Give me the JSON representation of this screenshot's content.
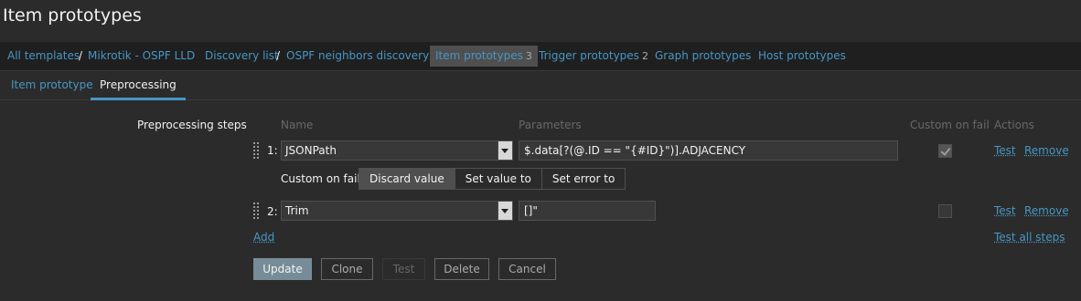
{
  "page": {
    "title": "Item prototypes"
  },
  "breadcrumbs": {
    "all_templates": "All templates",
    "template": "Mikrotik - OSPF LLD",
    "discovery_list": "Discovery list",
    "discovery_rule": "OSPF neighbors discovery",
    "item_prototypes": "Item prototypes",
    "item_prototypes_count": "3",
    "trigger_prototypes": "Trigger prototypes",
    "trigger_prototypes_count": "2",
    "graph_prototypes": "Graph prototypes",
    "host_prototypes": "Host prototypes",
    "separator": "/"
  },
  "tabs": [
    {
      "label": "Item prototype",
      "active": false
    },
    {
      "label": "Preprocessing",
      "active": true
    }
  ],
  "preprocessing": {
    "label": "Preprocessing steps",
    "columns": {
      "name": "Name",
      "parameters": "Parameters",
      "custom_on_fail": "Custom on fail",
      "actions": "Actions"
    },
    "steps": [
      {
        "num": "1:",
        "name": "JSONPath",
        "param": "$.data[?(@.ID == \"{#ID}\")].ADJACENCY",
        "custom_on_fail": true,
        "test": "Test",
        "remove": "Remove"
      },
      {
        "num": "2:",
        "name": "Trim",
        "param": "[]\"",
        "custom_on_fail": false,
        "test": "Test",
        "remove": "Remove"
      }
    ],
    "custom_on_fail_row": {
      "label": "Custom on fail",
      "options": [
        "Discard value",
        "Set value to",
        "Set error to"
      ],
      "selected": "Discard value"
    },
    "add_label": "Add",
    "test_all_label": "Test all steps"
  },
  "buttons": {
    "update": "Update",
    "clone": "Clone",
    "test": "Test",
    "delete": "Delete",
    "cancel": "Cancel"
  },
  "colors": {
    "background": "#2b2b2b",
    "link": "#4796c4",
    "primary_button": "#768d99"
  }
}
